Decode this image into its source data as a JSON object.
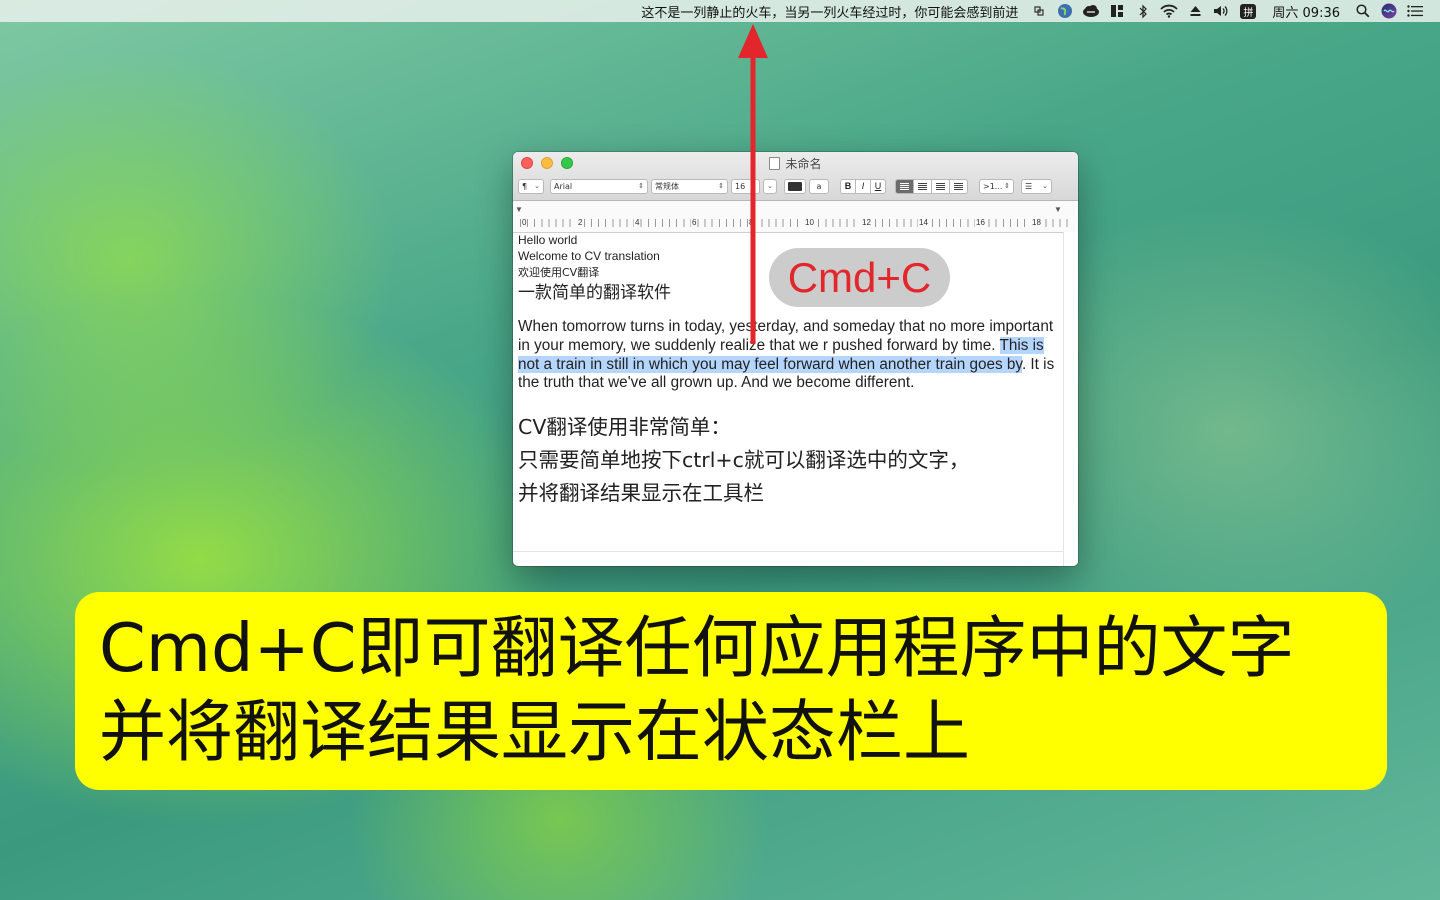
{
  "menubar": {
    "translation_text": "这不是一列静止的火车，当另一列火车经过时，你可能会感到前进",
    "input_source": "拼",
    "clock": "周六 09:36",
    "icons": [
      "cv-translate-icon",
      "globe-icon",
      "cloud-sync-icon",
      "window-layout-icon",
      "bluetooth-icon",
      "wifi-icon",
      "eject-icon",
      "volume-icon",
      "input-source-icon",
      "search-icon",
      "siri-icon",
      "notification-list-icon"
    ]
  },
  "window": {
    "title": "未命名",
    "toolbar": {
      "paragraph_style": "¶",
      "font_family": "Arial",
      "font_style": "常规体",
      "font_size": "16",
      "bold": "B",
      "italic": "I",
      "underline": "U",
      "spacing": ">1...",
      "list": "☰",
      "text_color": "#333333",
      "highlight_label": "a"
    },
    "ruler": [
      "0",
      "2",
      "4",
      "6",
      "8",
      "10",
      "12",
      "14",
      "16",
      "18"
    ],
    "document": {
      "line1": "Hello world",
      "line2": "Welcome to CV translation",
      "line3": "欢迎使用CV翻译",
      "line4": "一款简单的翻译软件",
      "paragraph_before": "When tomorrow turns in today, yesterday, and someday that no more important in your memory, we suddenly realize that we r pushed forward by time. ",
      "paragraph_selected": "This is not a train in still in which you may feel forward when another train goes by",
      "paragraph_after": ". It is the truth that we've all grown up. And we become different.",
      "cn_line1": "CV翻译使用非常简单：",
      "cn_line2": "只需要简单地按下ctrl+c就可以翻译选中的文字，",
      "cn_line3": "并将翻译结果显示在工具栏"
    }
  },
  "overlay": {
    "shortcut_label": "Cmd+C",
    "arrow_color": "#e3262b"
  },
  "banner": {
    "line1": "Cmd+C即可翻译任何应用程序中的文字",
    "line2": "并将翻译结果显示在状态栏上",
    "color": "#ffff00"
  }
}
